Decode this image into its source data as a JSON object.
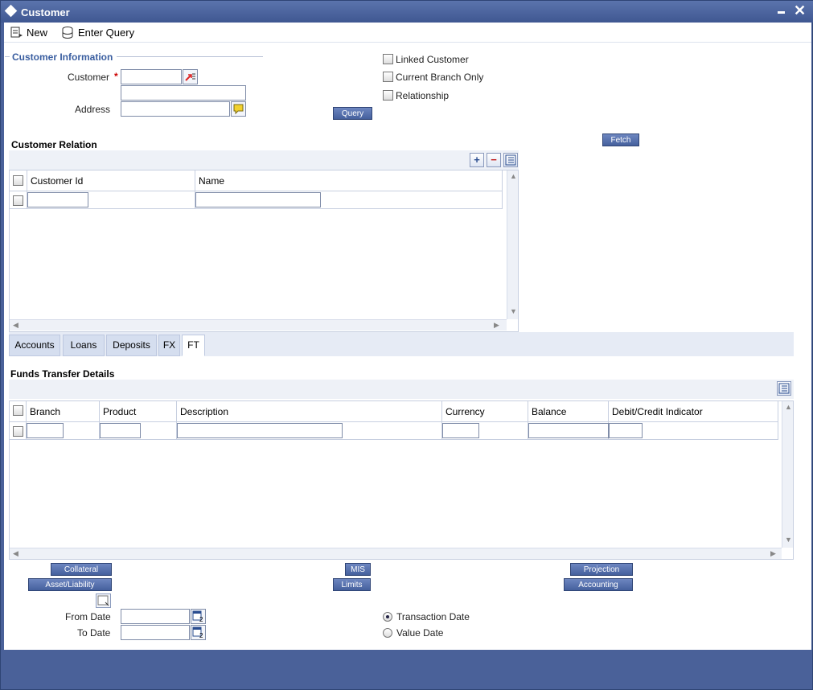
{
  "window": {
    "title": "Customer"
  },
  "toolbar": {
    "new_label": "New",
    "enter_query_label": "Enter Query"
  },
  "customer_info": {
    "section_title": "Customer Information",
    "customer_label": "Customer",
    "required_mark": "*",
    "address_label": "Address",
    "query_button": "Query"
  },
  "options": {
    "linked_customer": "Linked Customer",
    "current_branch_only": "Current Branch Only",
    "relationship": "Relationship"
  },
  "fetch_button": "Fetch",
  "customer_relation": {
    "title": "Customer Relation",
    "columns": [
      "Customer Id",
      "Name"
    ]
  },
  "tabs": [
    "Accounts",
    "Loans",
    "Deposits",
    "FX",
    "FT"
  ],
  "funds_transfer": {
    "title": "Funds Transfer Details",
    "columns": [
      "Branch",
      "Product",
      "Description",
      "Currency",
      "Balance",
      "Debit/Credit Indicator"
    ]
  },
  "action_buttons": {
    "collateral": "Collateral",
    "asset_liability": "Asset/Liability",
    "mis": "MIS",
    "limits": "Limits",
    "projection": "Projection",
    "accounting": "Accounting"
  },
  "dates": {
    "from_label": "From Date",
    "to_label": "To Date",
    "transaction_date": "Transaction Date",
    "value_date": "Value Date"
  },
  "colors": {
    "header_blue": "#4a6199",
    "button_blue": "#45609d"
  }
}
